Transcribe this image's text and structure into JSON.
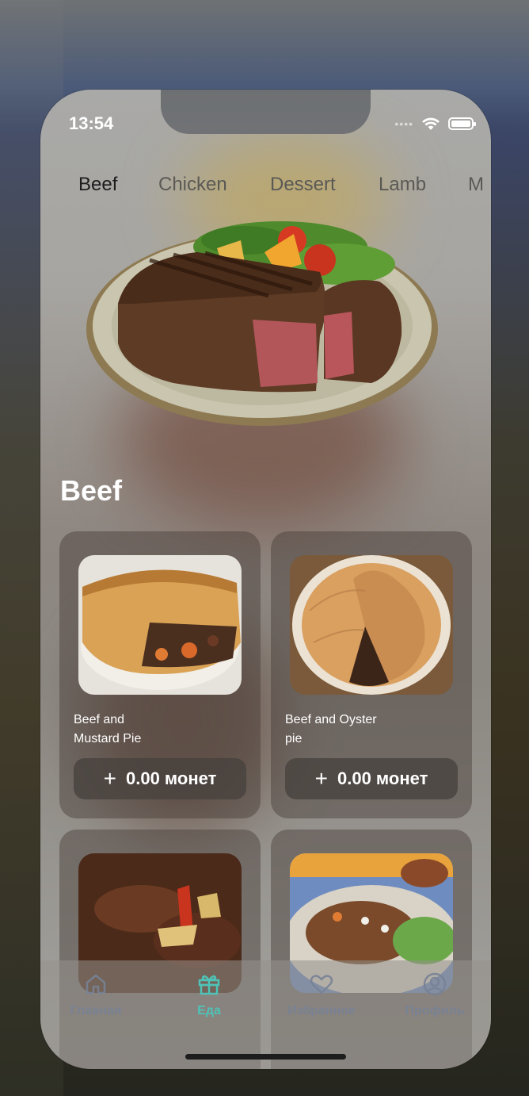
{
  "status": {
    "time": "13:54"
  },
  "tabs": [
    {
      "label": "Beef",
      "active": true
    },
    {
      "label": "Chicken",
      "active": false
    },
    {
      "label": "Dessert",
      "active": false
    },
    {
      "label": "Lamb",
      "active": false
    },
    {
      "label": "M",
      "active": false
    }
  ],
  "section": {
    "title": "Beef"
  },
  "meals": [
    {
      "name_line1": "Beef and",
      "name_line2": "Mustard Pie",
      "plus": "+",
      "price": "0.00 монет"
    },
    {
      "name_line1": "Beef and Oyster",
      "name_line2": "pie",
      "plus": "+",
      "price": "0.00 монет"
    },
    {
      "name_line1": "",
      "name_line2": "",
      "plus": "",
      "price": ""
    },
    {
      "name_line1": "",
      "name_line2": "",
      "plus": "",
      "price": ""
    }
  ],
  "nav": [
    {
      "label": "Главная",
      "icon": "home-icon",
      "active": false
    },
    {
      "label": "Еда",
      "icon": "gift-icon",
      "active": true
    },
    {
      "label": "Избранное",
      "icon": "heart-icon",
      "active": false
    },
    {
      "label": "Профиль",
      "icon": "profile-icon",
      "active": false
    }
  ],
  "colors": {
    "accent": "#4fc3b7",
    "inactive_nav": "#7882a0"
  }
}
